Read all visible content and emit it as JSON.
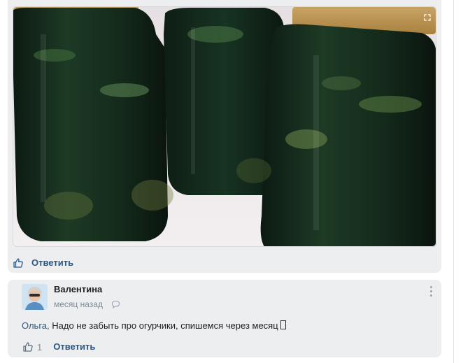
{
  "post": {
    "photo_alt": "",
    "reply_label": "Ответить"
  },
  "comment": {
    "author": "Валентина",
    "time": "месяц назад",
    "mention": "Ольга,",
    "text": " Надо не забыть про огурчики, спишемся через месяц",
    "like_count": "1",
    "reply_label": "Ответить"
  },
  "colors": {
    "link": "#2a5885",
    "card_bg": "#edeef0",
    "muted": "#818c99"
  },
  "icons": [
    "thumbs-up-icon",
    "comment-bubble-icon",
    "more-vertical-icon",
    "fullscreen-icon"
  ]
}
